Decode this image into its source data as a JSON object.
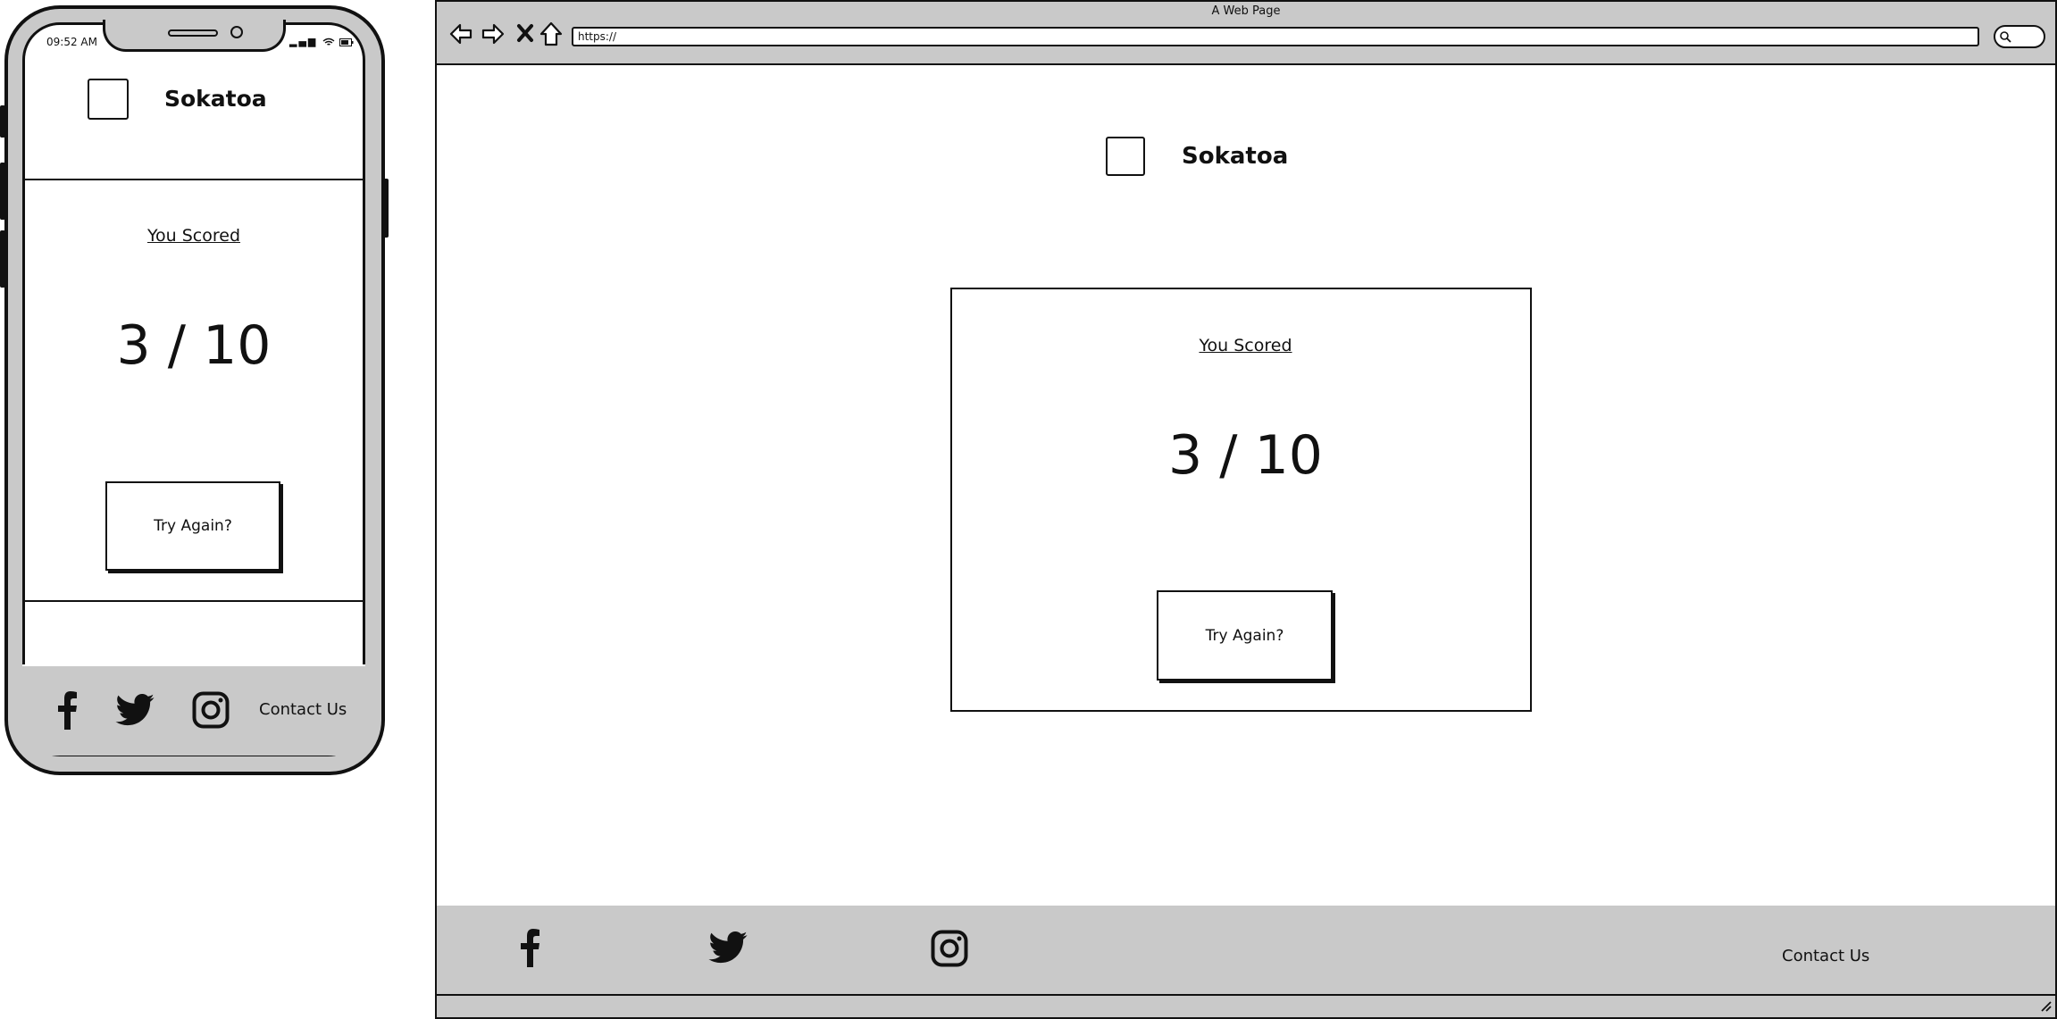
{
  "mobile": {
    "status_time": "09:52 AM",
    "site_title": "Sokatoa",
    "you_scored": "You Scored",
    "score": "3 / 10",
    "try_again": "Try Again?",
    "footer": {
      "icons": [
        "facebook-icon",
        "twitter-icon",
        "instagram-icon"
      ],
      "contact": "Contact Us"
    }
  },
  "browser": {
    "window_title": "A Web Page",
    "url": "https://",
    "site_title": "Sokatoa",
    "you_scored": "You Scored",
    "score": "3 / 10",
    "try_again": "Try Again?",
    "footer": {
      "icons": [
        "facebook-icon",
        "twitter-icon",
        "instagram-icon"
      ],
      "contact": "Contact Us"
    }
  },
  "colors": {
    "chrome_gray": "#c9c9c9",
    "ink": "#111111",
    "background": "#ffffff"
  }
}
